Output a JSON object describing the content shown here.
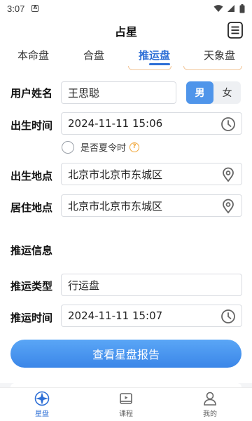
{
  "status_bar": {
    "time": "3:07",
    "notification_letter": "A"
  },
  "header": {
    "title": "占星"
  },
  "tabs": [
    {
      "label": "本命盘",
      "active": false
    },
    {
      "label": "合盘",
      "active": false
    },
    {
      "label": "推运盘",
      "active": true
    },
    {
      "label": "天象盘",
      "active": false
    }
  ],
  "form": {
    "name_label": "用户姓名",
    "name_value": "王思聪",
    "gender_options": [
      "男",
      "女"
    ],
    "gender_selected": "男",
    "birth_time_label": "出生时间",
    "birth_time_value": "2024-11-11 15:06",
    "dst_label": "是否夏令时",
    "dst_help": "?",
    "dst_checked": false,
    "birth_place_label": "出生地点",
    "birth_place_value": "北京市北京市东城区",
    "residence_label": "居住地点",
    "residence_value": "北京市北京市东城区"
  },
  "progression": {
    "section_title": "推运信息",
    "type_label": "推运类型",
    "type_value": "行运盘",
    "time_label": "推运时间",
    "time_value": "2024-11-11 15:07"
  },
  "cta_label": "查看星盘报告",
  "bottom_nav": [
    {
      "label": "星盘",
      "icon": "compass-star-icon",
      "active": true
    },
    {
      "label": "课程",
      "icon": "video-course-icon",
      "active": false
    },
    {
      "label": "我的",
      "icon": "user-profile-icon",
      "active": false
    }
  ],
  "colors": {
    "accent": "#2e6fd6",
    "button_blue": "#4f95ea",
    "help_orange": "#f0a73a"
  }
}
